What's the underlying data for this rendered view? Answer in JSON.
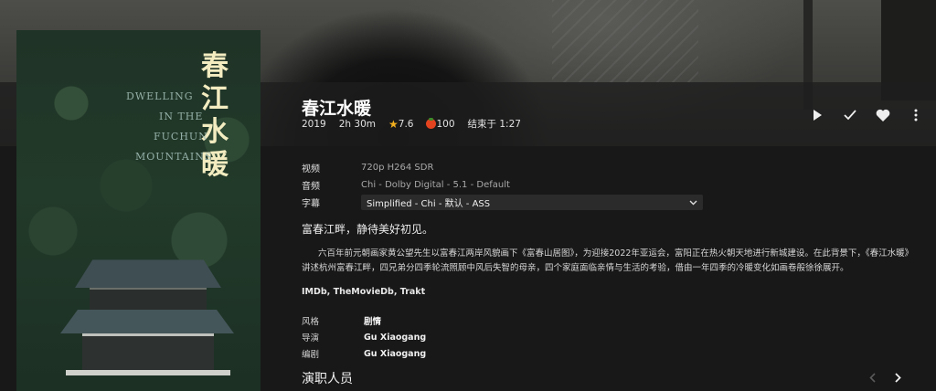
{
  "movie": {
    "title": "春江水暖",
    "year": "2019",
    "runtime": "2h 30m",
    "community_rating": "7.6",
    "critic_rating": "100",
    "ends_at": "结束于 1:27"
  },
  "poster": {
    "title_cn_lines": [
      "春",
      "江",
      "水",
      "暖"
    ],
    "title_en_lines": [
      "DWELLING",
      "IN THE",
      "FUCHUN",
      "MOUNTAINS"
    ]
  },
  "actions": {
    "play_icon": "play-icon",
    "watched_icon": "check-icon",
    "favorite_icon": "heart-icon",
    "more_icon": "more-vertical-icon"
  },
  "media_info": {
    "video_label": "视频",
    "video_value": "720p H264 SDR",
    "audio_label": "音频",
    "audio_value": "Chi - Dolby Digital - 5.1 - Default",
    "subtitle_label": "字幕",
    "subtitle_value": "Simplified - Chi - 默认 - ASS"
  },
  "tagline": "富春江畔，静待美好初见。",
  "overview": "六百年前元朝画家黄公望先生以富春江两岸风貌画下《富春山居图》，为迎接2022年亚运会，富阳正在热火朝天地进行新城建设。在此背景下，《春江水暖》讲述杭州富春江畔，四兄弟分四季轮流照顾中风后失智的母亲，四个家庭面临亲情与生活的考验，借由一年四季的冷暖变化如画卷般徐徐展开。",
  "external_links": "IMDb, TheMovieDb, Trakt",
  "credits": {
    "genre_label": "风格",
    "genre_value": "剧情",
    "director_label": "导演",
    "director_value": "Gu Xiaogang",
    "writer_label": "编剧",
    "writer_value": "Gu Xiaogang"
  },
  "cast": {
    "section_title": "演职人员",
    "prev_icon": "chevron-left-icon",
    "next_icon": "chevron-right-icon"
  },
  "colors": {
    "rating_star": "#f2b01e",
    "tomato": "#e3431f",
    "background": "#181818"
  }
}
